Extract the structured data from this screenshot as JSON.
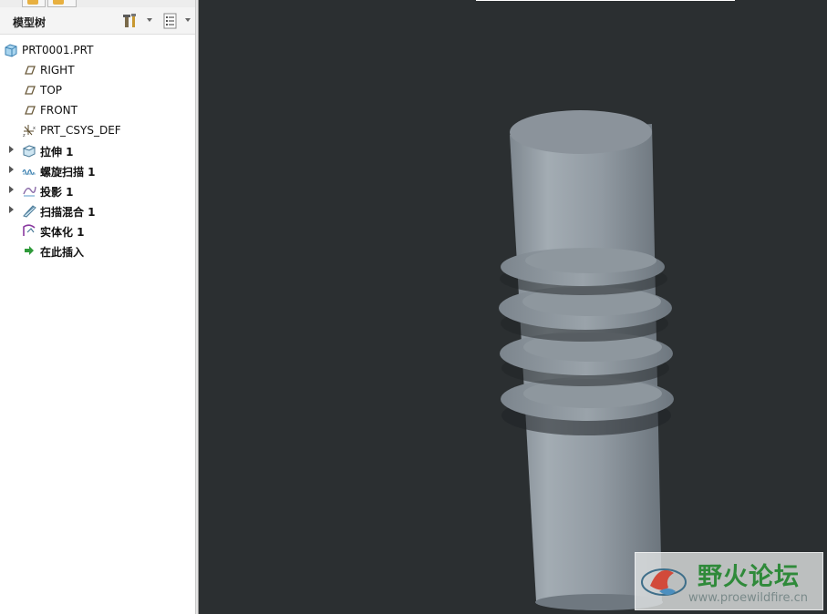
{
  "panel": {
    "title": "模型树",
    "tools": [
      {
        "icon": "settings-tools-icon"
      },
      {
        "icon": "show-list-icon"
      }
    ]
  },
  "tree": {
    "items": [
      {
        "label": "PRT0001.PRT",
        "icon": "part-icon",
        "expandable": false,
        "bold": false
      },
      {
        "label": "RIGHT",
        "icon": "datum-plane-icon",
        "expandable": false,
        "bold": false
      },
      {
        "label": "TOP",
        "icon": "datum-plane-icon",
        "expandable": false,
        "bold": false
      },
      {
        "label": "FRONT",
        "icon": "datum-plane-icon",
        "expandable": false,
        "bold": false
      },
      {
        "label": "PRT_CSYS_DEF",
        "icon": "coordinate-system-icon",
        "expandable": false,
        "bold": false
      },
      {
        "label": "拉伸 1",
        "icon": "extrude-icon",
        "expandable": true,
        "bold": true
      },
      {
        "label": "螺旋扫描 1",
        "icon": "helical-sweep-icon",
        "expandable": true,
        "bold": true
      },
      {
        "label": "投影 1",
        "icon": "projection-icon",
        "expandable": true,
        "bold": true
      },
      {
        "label": "扫描混合 1",
        "icon": "swept-blend-icon",
        "expandable": true,
        "bold": true
      },
      {
        "label": "实体化 1",
        "icon": "solidify-icon",
        "expandable": false,
        "bold": true
      },
      {
        "label": "在此插入",
        "icon": "insert-here-arrow-icon",
        "expandable": false,
        "bold": true
      }
    ]
  },
  "viewport": {
    "background": "#2b2f31",
    "model_color": "#8d969e"
  },
  "watermark": {
    "title": "野火论坛",
    "url": "www.proewildfire.cn"
  }
}
